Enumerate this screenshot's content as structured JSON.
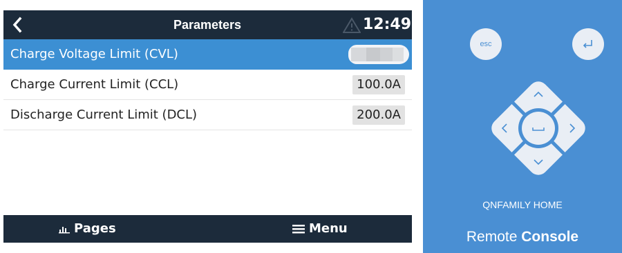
{
  "header": {
    "title": "Parameters",
    "clock": "12:49",
    "back_icon": "chevron-left-icon",
    "alarm_icon": "warning-triangle-icon"
  },
  "parameters": [
    {
      "label": "Charge Voltage Limit (CVL)",
      "value": "",
      "selected": true
    },
    {
      "label": "Charge Current Limit (CCL)",
      "value": "100.0A",
      "selected": false
    },
    {
      "label": "Discharge Current Limit (DCL)",
      "value": "200.0A",
      "selected": false
    }
  ],
  "footer": {
    "pages_label": "Pages",
    "pages_icon": "bar-chart-icon",
    "menu_label": "Menu",
    "menu_icon": "hamburger-icon"
  },
  "remote": {
    "esc_label": "esc",
    "enter_icon": "return-icon",
    "brand": "QNFAMILY HOME",
    "title_light": "Remote",
    "title_bold": "Console"
  },
  "colors": {
    "header_bg": "#1c2b3b",
    "selection": "#3c8fd3",
    "panel_bg": "#4a8fd3"
  }
}
